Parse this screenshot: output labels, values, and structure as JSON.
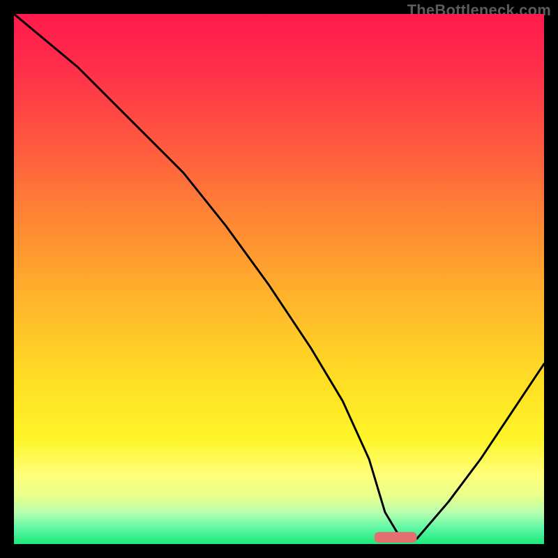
{
  "watermark": "TheBottleneck.com",
  "chart_data": {
    "type": "line",
    "title": "",
    "xlabel": "",
    "ylabel": "",
    "xlim": [
      0,
      100
    ],
    "ylim": [
      0,
      100
    ],
    "grid": false,
    "series": [
      {
        "name": "bottleneck-curve",
        "x": [
          0,
          12,
          24,
          32,
          40,
          48,
          56,
          62,
          67,
          70,
          73,
          76,
          82,
          88,
          94,
          100
        ],
        "values": [
          100,
          90,
          78,
          70,
          60,
          49,
          37,
          27,
          16,
          6,
          1,
          1,
          8,
          16,
          25,
          34
        ],
        "color": "#000000"
      }
    ],
    "marker": {
      "name": "sweet-spot-marker",
      "x_center": 72,
      "width": 8,
      "height": 2,
      "color": "#e36f6f"
    },
    "background_gradient_stops": [
      {
        "pos": 0,
        "color": "#ff1a4d"
      },
      {
        "pos": 10,
        "color": "#ff2e4a"
      },
      {
        "pos": 25,
        "color": "#ff5a3f"
      },
      {
        "pos": 40,
        "color": "#ff8a33"
      },
      {
        "pos": 55,
        "color": "#ffb82a"
      },
      {
        "pos": 70,
        "color": "#ffe024"
      },
      {
        "pos": 80,
        "color": "#fff428"
      },
      {
        "pos": 87,
        "color": "#ffff7a"
      },
      {
        "pos": 91,
        "color": "#e8ff8c"
      },
      {
        "pos": 94,
        "color": "#b8ffad"
      },
      {
        "pos": 97,
        "color": "#5ef7a6"
      },
      {
        "pos": 100,
        "color": "#1ce77a"
      }
    ]
  }
}
